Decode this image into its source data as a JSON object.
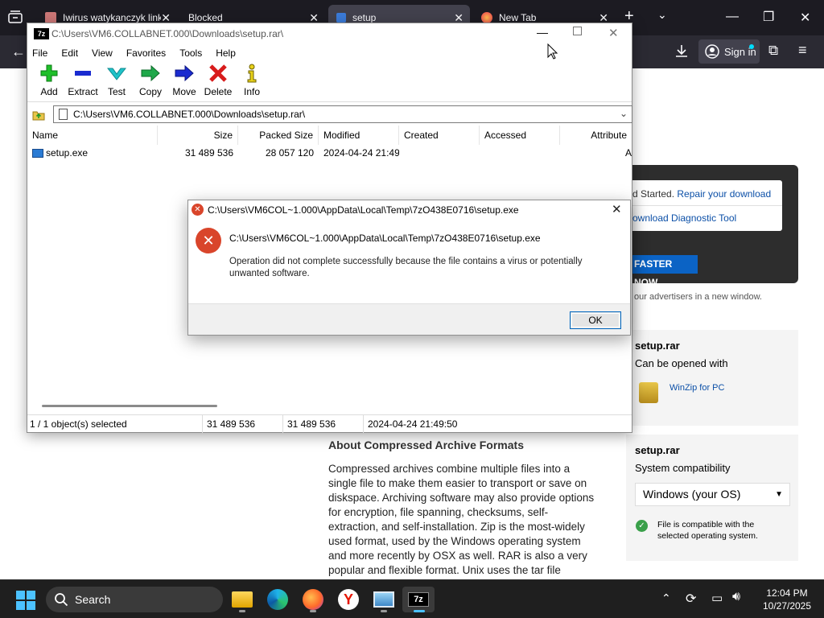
{
  "browser": {
    "tabs": [
      {
        "title": "Iwirus watykanczyk link"
      },
      {
        "title": "Blocked"
      },
      {
        "title": "setup"
      },
      {
        "title": "New Tab"
      }
    ],
    "sign_in": "Sign in"
  },
  "webpage": {
    "card1_line1": "d Started.",
    "card1_link1": "Repair your download",
    "card1_link2": "ownload Diagnostic Tool",
    "faster_btn": "FASTER NOW",
    "advertisers": "our advertisers in a new window.",
    "card2_title": "setup.rar",
    "card2_sub": "Can be opened with",
    "card2_app": "WinZip for PC",
    "card3_title": "setup.rar",
    "card3_sub": "System compatibility",
    "card3_select": "Windows (your OS)",
    "card3_ok": "File is compatible with the selected operating system.",
    "article_title": "About Compressed Archive Formats",
    "article_body": "Compressed archives combine multiple files into a single file to make them easier to transport or save on diskspace. Archiving software may also provide options for encryption, file spanning, checksums, self-extraction, and self-installation. Zip is the most-widely used format, used by the Windows operating system and more recently by OSX as well. RAR is also a very popular and flexible format. Unix uses the tar file format, while Linux"
  },
  "sevenzip": {
    "title": "C:\\Users\\VM6.COLLABNET.000\\Downloads\\setup.rar\\",
    "menu": [
      "File",
      "Edit",
      "View",
      "Favorites",
      "Tools",
      "Help"
    ],
    "toolbar": [
      "Add",
      "Extract",
      "Test",
      "Copy",
      "Move",
      "Delete",
      "Info"
    ],
    "address": "C:\\Users\\VM6.COLLABNET.000\\Downloads\\setup.rar\\",
    "columns": [
      "Name",
      "Size",
      "Packed Size",
      "Modified",
      "Created",
      "Accessed",
      "Attribute"
    ],
    "row": {
      "name": "setup.exe",
      "size": "31 489 536",
      "packed": "28 057 120",
      "modified": "2024-04-24 21:49",
      "attr": "A"
    },
    "status": {
      "selected": "1 / 1 object(s) selected",
      "size": "31 489 536",
      "packed": "31 489 536",
      "date": "2024-04-24 21:49:50"
    }
  },
  "dialog": {
    "title": "C:\\Users\\VM6COL~1.000\\AppData\\Local\\Temp\\7zO438E0716\\setup.exe",
    "path": "C:\\Users\\VM6COL~1.000\\AppData\\Local\\Temp\\7zO438E0716\\setup.exe",
    "message": "Operation did not complete successfully because the file contains a virus or potentially unwanted software.",
    "ok": "OK"
  },
  "taskbar": {
    "search": "Search",
    "time": "12:04 PM",
    "date": "10/27/2025"
  }
}
